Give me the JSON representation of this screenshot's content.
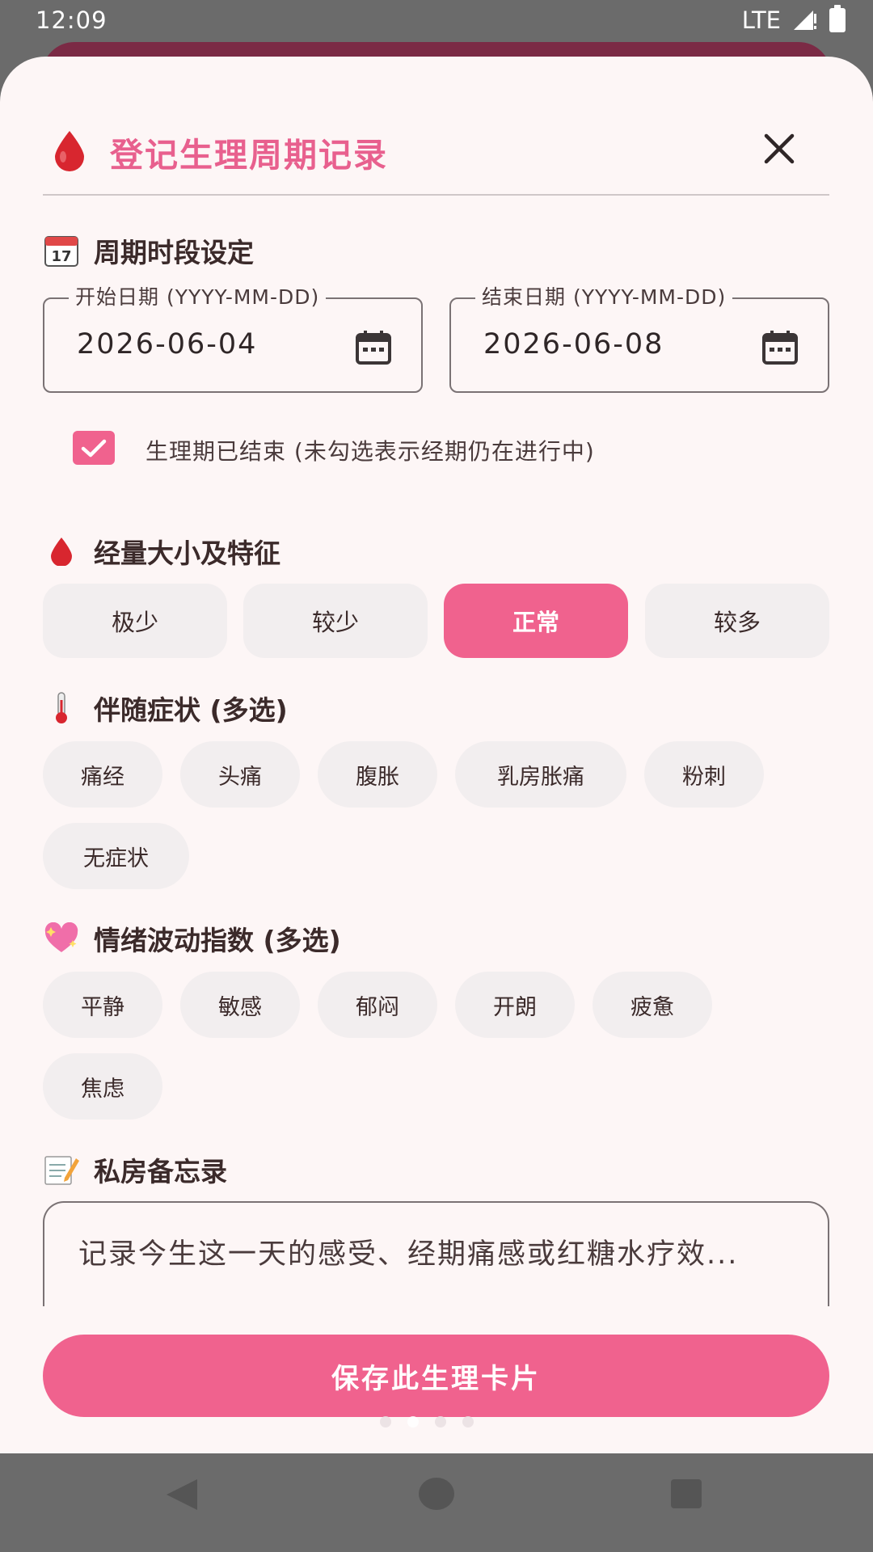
{
  "status_bar": {
    "time": "12:09",
    "network": "LTE"
  },
  "dialog": {
    "title": "登记生理周期记录",
    "icons": {
      "title": "blood-drop-icon",
      "close": "close-icon"
    }
  },
  "period_section": {
    "title": "周期时段设定",
    "icon": "calendar-icon",
    "start_date": {
      "label": "开始日期 (YYYY-MM-DD)",
      "value": "2026-06-04"
    },
    "end_date": {
      "label": "结束日期 (YYYY-MM-DD)",
      "value": "2026-06-08"
    },
    "ended_checkbox": {
      "checked": true,
      "label": "生理期已结束 (未勾选表示经期仍在进行中)"
    }
  },
  "flow_section": {
    "title": "经量大小及特征",
    "icon": "blood-drop-icon",
    "options": [
      "极少",
      "较少",
      "正常",
      "较多"
    ],
    "selected": "正常"
  },
  "symptoms_section": {
    "title": "伴随症状 (多选)",
    "icon": "thermometer-icon",
    "options": [
      "痛经",
      "头痛",
      "腹胀",
      "乳房胀痛",
      "粉刺",
      "无症状"
    ]
  },
  "mood_section": {
    "title": "情绪波动指数 (多选)",
    "icon": "sparkling-heart-icon",
    "options": [
      "平静",
      "敏感",
      "郁闷",
      "开朗",
      "疲惫",
      "焦虑"
    ]
  },
  "memo_section": {
    "title": "私房备忘录",
    "icon": "memo-icon",
    "placeholder": "记录今生这一天的感受、经期痛感或红糖水疗效..."
  },
  "save_button": {
    "label": "保存此生理卡片"
  },
  "colors": {
    "accent": "#f0628e",
    "title": "#e8608e",
    "background": "#fdf6f6",
    "chip": "#f2eeef"
  }
}
